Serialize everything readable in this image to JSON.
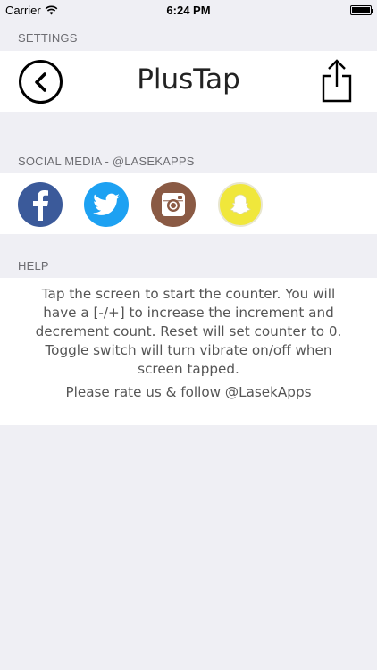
{
  "status_bar": {
    "carrier": "Carrier",
    "time": "6:24 PM",
    "battery_level": 1.0
  },
  "settings_section": {
    "header": "SETTINGS"
  },
  "nav": {
    "title": "PlusTap",
    "back_icon": "chevron-left-circle-icon",
    "share_icon": "share-icon"
  },
  "social_section": {
    "header": "SOCIAL MEDIA - @LASEKAPPS",
    "items": [
      {
        "name": "facebook",
        "color": "#3b5a9a",
        "icon": "facebook-icon"
      },
      {
        "name": "twitter",
        "color": "#1da1f2",
        "icon": "twitter-icon"
      },
      {
        "name": "instagram",
        "color": "#8a5a44",
        "icon": "instagram-icon"
      },
      {
        "name": "snapchat",
        "color": "#f0e73b",
        "icon": "snapchat-icon"
      }
    ]
  },
  "help_section": {
    "header": "HELP",
    "text": "Tap the screen to start the counter. You will have a [-/+] to increase the increment and decrement count. Reset will set counter to 0. Toggle switch will turn vibrate on/off when screen tapped.",
    "rate_text": "Please rate us & follow @LasekApps"
  }
}
